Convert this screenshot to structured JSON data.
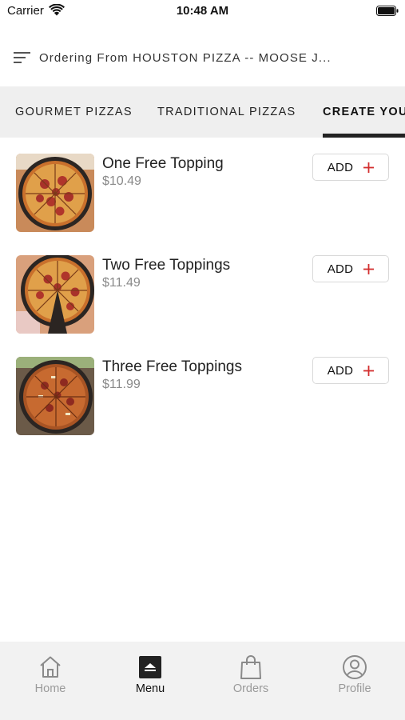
{
  "status_bar": {
    "carrier": "Carrier",
    "time": "10:48 AM"
  },
  "header": {
    "title": "Ordering From HOUSTON PIZZA -- MOOSE J..."
  },
  "tabs": [
    {
      "label": "GOURMET PIZZAS",
      "active": false
    },
    {
      "label": "TRADITIONAL PIZZAS",
      "active": false
    },
    {
      "label": "CREATE YOUR OWN",
      "active": true
    }
  ],
  "products": [
    {
      "name": "One Free Topping",
      "price": "$10.49",
      "add_label": "ADD",
      "image": "pepperoni-pizza-image"
    },
    {
      "name": "Two Free Toppings",
      "price": "$11.49",
      "add_label": "ADD",
      "image": "sliced-pizza-image"
    },
    {
      "name": "Three Free Toppings",
      "price": "$11.99",
      "add_label": "ADD",
      "image": "deep-dish-pizza-image"
    }
  ],
  "bottom_nav": [
    {
      "label": "Home",
      "icon": "home-icon",
      "active": false
    },
    {
      "label": "Menu",
      "icon": "menu-book-icon",
      "active": true
    },
    {
      "label": "Orders",
      "icon": "shopping-bag-icon",
      "active": false
    },
    {
      "label": "Profile",
      "icon": "profile-icon",
      "active": false
    }
  ],
  "colors": {
    "accent": "#d32f2f",
    "tab_bar_bg": "#efefef",
    "nav_bg": "#f2f2f2",
    "active_text": "#111111",
    "inactive_text": "#9a9a9a"
  }
}
